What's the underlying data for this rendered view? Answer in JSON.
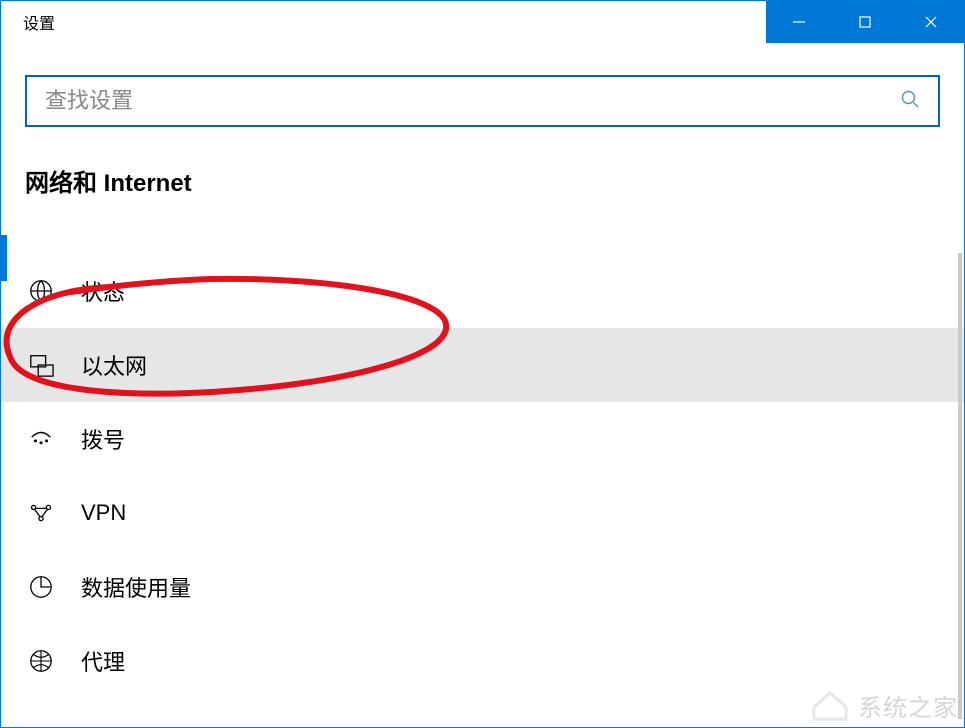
{
  "titlebar": {
    "title": "设置"
  },
  "search": {
    "placeholder": "查找设置"
  },
  "section": {
    "title": "网络和 Internet"
  },
  "nav": {
    "items": [
      {
        "label": "状态"
      },
      {
        "label": "以太网"
      },
      {
        "label": "拨号"
      },
      {
        "label": "VPN"
      },
      {
        "label": "数据使用量"
      },
      {
        "label": "代理"
      }
    ]
  },
  "watermark": {
    "text": "系统之家"
  }
}
